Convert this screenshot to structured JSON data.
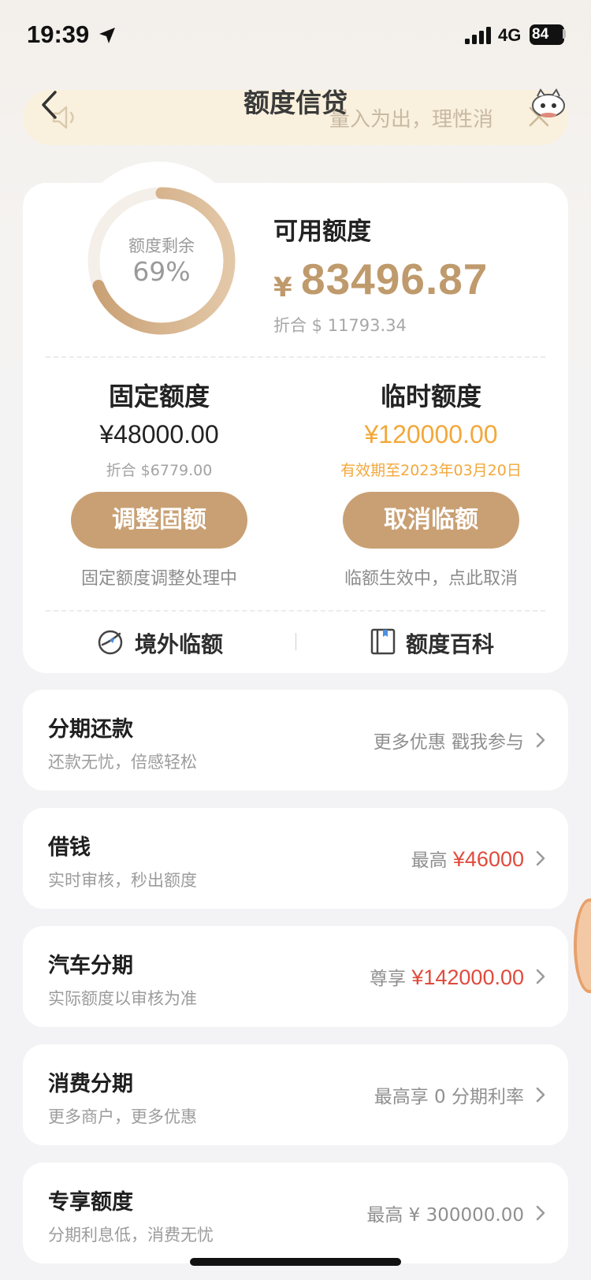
{
  "status_bar": {
    "time": "19:39",
    "network": "4G",
    "battery": "84"
  },
  "header": {
    "title": "额度信贷",
    "notice": "量入为出，理性消费"
  },
  "summary": {
    "ring_label": "额度剩余",
    "ring_percent": "69%",
    "ring_fraction": 0.69,
    "available_label": "可用额度",
    "currency_symbol": "¥",
    "available_amount": "83496.87",
    "available_usd": "折合 $ 11793.34"
  },
  "fixed": {
    "title": "固定额度",
    "amount": "¥48000.00",
    "sub": "折合 $6779.00",
    "button": "调整固额",
    "note": "固定额度调整处理中"
  },
  "temporary": {
    "title": "临时额度",
    "amount": "¥120000.00",
    "sub": "有效期至2023年03月20日",
    "button": "取消临额",
    "note": "临额生效中，点此取消"
  },
  "links": {
    "overseas": "境外临额",
    "encyclopedia": "额度百科"
  },
  "rows": [
    {
      "title": "分期还款",
      "sub": "还款无忧，倍感轻松",
      "right_prefix": "更多优惠 戳我参与",
      "right_value": ""
    },
    {
      "title": "借钱",
      "sub": "实时审核，秒出额度",
      "right_prefix": "最高 ",
      "right_value": "¥46000"
    },
    {
      "title": "汽车分期",
      "sub": "实际额度以审核为准",
      "right_prefix": "尊享 ",
      "right_value": "¥142000.00"
    },
    {
      "title": "消费分期",
      "sub": "更多商户，更多优惠",
      "right_prefix": "最高享 0 分期利率",
      "right_value": ""
    },
    {
      "title": "专享额度",
      "sub": "分期利息低，消费无忧",
      "right_prefix": "最高 ¥ 300000.00",
      "right_value": ""
    }
  ],
  "colors": {
    "gold": "#c9a074",
    "amount_gold": "#bf9a6c",
    "temp_orange": "#f2a83b",
    "accent_red": "#e04a3c"
  }
}
